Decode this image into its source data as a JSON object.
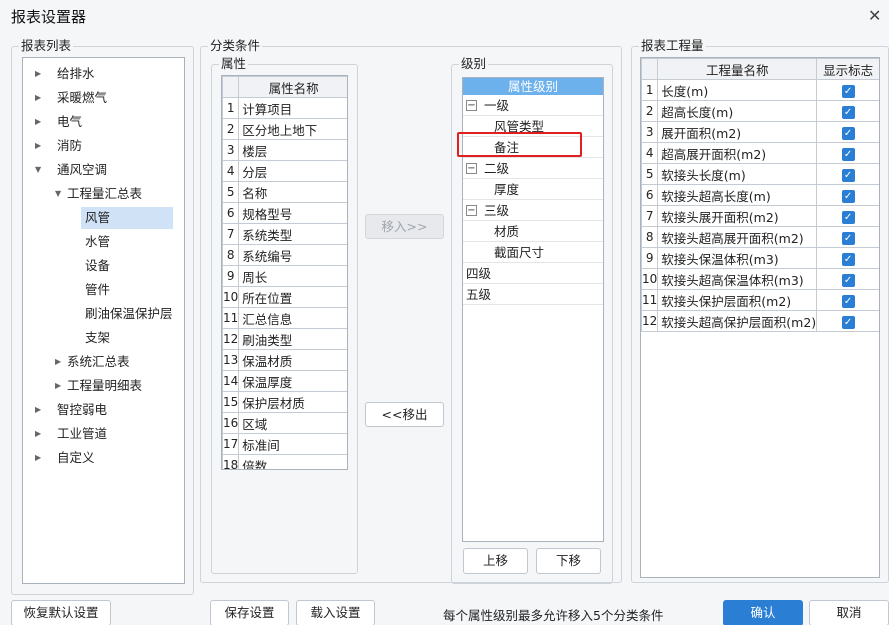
{
  "window": {
    "title": "报表设置器",
    "close_glyph": "✕"
  },
  "report_list": {
    "label": "报表列表",
    "tree": [
      {
        "label": "给排水"
      },
      {
        "label": "采暖燃气"
      },
      {
        "label": "电气"
      },
      {
        "label": "消防"
      },
      {
        "label": "通风空调"
      },
      {
        "label": "工程量汇总表"
      },
      {
        "label": "风管"
      },
      {
        "label": "水管"
      },
      {
        "label": "设备"
      },
      {
        "label": "管件"
      },
      {
        "label": "刷油保温保护层"
      },
      {
        "label": "支架"
      },
      {
        "label": "系统汇总表"
      },
      {
        "label": "工程量明细表"
      },
      {
        "label": "智控弱电"
      },
      {
        "label": "工业管道"
      },
      {
        "label": "自定义"
      }
    ]
  },
  "classify": {
    "label": "分类条件",
    "attributes": {
      "label": "属性",
      "header": "属性名称",
      "rows": [
        {
          "n": "1",
          "name": "计算项目"
        },
        {
          "n": "2",
          "name": "区分地上地下"
        },
        {
          "n": "3",
          "name": "楼层"
        },
        {
          "n": "4",
          "name": "分层"
        },
        {
          "n": "5",
          "name": "名称"
        },
        {
          "n": "6",
          "name": "规格型号"
        },
        {
          "n": "7",
          "name": "系统类型"
        },
        {
          "n": "8",
          "name": "系统编号"
        },
        {
          "n": "9",
          "name": "周长"
        },
        {
          "n": "10",
          "name": "所在位置"
        },
        {
          "n": "11",
          "name": "汇总信息"
        },
        {
          "n": "12",
          "name": "刷油类型"
        },
        {
          "n": "13",
          "name": "保温材质"
        },
        {
          "n": "14",
          "name": "保温厚度"
        },
        {
          "n": "15",
          "name": "保护层材质"
        },
        {
          "n": "16",
          "name": "区域"
        },
        {
          "n": "17",
          "name": "标准间"
        },
        {
          "n": "18",
          "name": "倍数"
        }
      ]
    },
    "move_in": "移入>>",
    "move_out": "<<移出",
    "levels": {
      "label": "级别",
      "header": "属性级别",
      "rows": [
        {
          "text": "一级"
        },
        {
          "text": "风管类型"
        },
        {
          "text": "备注"
        },
        {
          "text": "二级"
        },
        {
          "text": "厚度"
        },
        {
          "text": "三级"
        },
        {
          "text": "材质"
        },
        {
          "text": "截面尺寸"
        },
        {
          "text": "四级"
        },
        {
          "text": "五级"
        }
      ]
    },
    "move_up": "上移",
    "move_down": "下移"
  },
  "quantities": {
    "label": "报表工程量",
    "header_name": "工程量名称",
    "header_show": "显示标志",
    "rows": [
      {
        "n": "1",
        "name": "长度(m)",
        "show": true
      },
      {
        "n": "2",
        "name": "超高长度(m)",
        "show": true
      },
      {
        "n": "3",
        "name": "展开面积(m2)",
        "show": true
      },
      {
        "n": "4",
        "name": "超高展开面积(m2)",
        "show": true
      },
      {
        "n": "5",
        "name": "软接头长度(m)",
        "show": true
      },
      {
        "n": "6",
        "name": "软接头超高长度(m)",
        "show": true
      },
      {
        "n": "7",
        "name": "软接头展开面积(m2)",
        "show": true
      },
      {
        "n": "8",
        "name": "软接头超高展开面积(m2)",
        "show": true
      },
      {
        "n": "9",
        "name": "软接头保温体积(m3)",
        "show": true
      },
      {
        "n": "10",
        "name": "软接头超高保温体积(m3)",
        "show": true
      },
      {
        "n": "11",
        "name": "软接头保护层面积(m2)",
        "show": true
      },
      {
        "n": "12",
        "name": "软接头超高保护层面积(m2)",
        "show": true
      }
    ]
  },
  "footer": {
    "restore": "恢复默认设置",
    "save": "保存设置",
    "load": "载入设置",
    "hint": "每个属性级别最多允许移入5个分类条件",
    "ok": "确认",
    "cancel": "取消"
  },
  "colors": {
    "accent": "#2a7fd4",
    "highlight": "#e02020",
    "selected": "#cfe2f6"
  }
}
